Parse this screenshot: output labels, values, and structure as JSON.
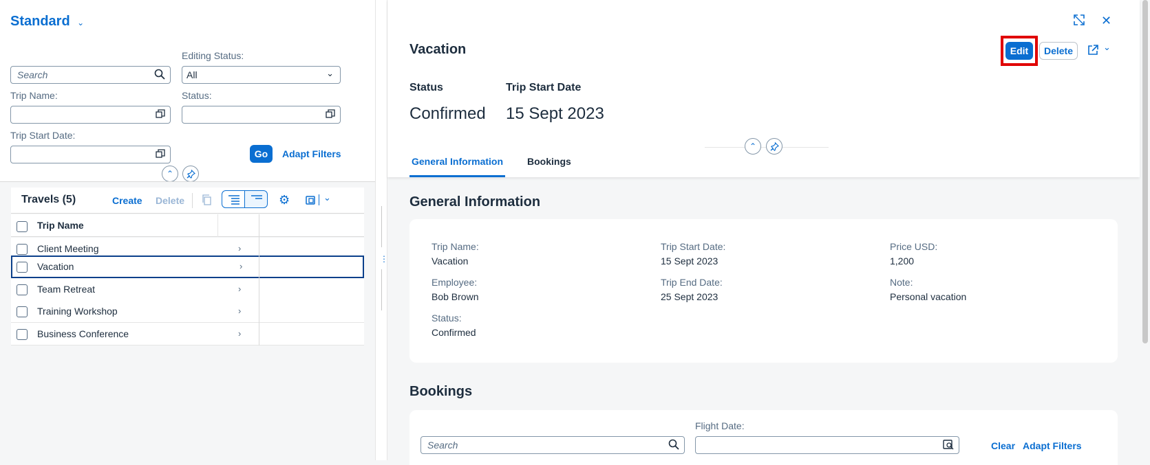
{
  "variant": {
    "title": "Standard"
  },
  "filters": {
    "search_placeholder": "Search",
    "editing_status_label": "Editing Status:",
    "editing_status_value": "All",
    "trip_name_label": "Trip Name:",
    "status_label": "Status:",
    "trip_start_date_label": "Trip Start Date:",
    "go_label": "Go",
    "adapt_filters_label": "Adapt Filters"
  },
  "table": {
    "title": "Travels (5)",
    "create_label": "Create",
    "delete_label": "Delete",
    "column_header": "Trip Name",
    "rows": [
      "Client Meeting",
      "Vacation",
      "Team Retreat",
      "Training Workshop",
      "Business Conference"
    ],
    "selected_row": "Vacation"
  },
  "object": {
    "title": "Vacation",
    "edit_label": "Edit",
    "delete_label": "Delete",
    "status_header_label": "Status",
    "status_header_value": "Confirmed",
    "start_header_label": "Trip Start Date",
    "start_header_value": "15 Sept 2023",
    "tabs": [
      "General Information",
      "Bookings"
    ],
    "active_tab": "General Information"
  },
  "general": {
    "section_title": "General Information",
    "fields": [
      {
        "label": "Trip Name:",
        "value": "Vacation"
      },
      {
        "label": "Trip Start Date:",
        "value": "15 Sept 2023"
      },
      {
        "label": "Price USD:",
        "value": "1,200"
      },
      {
        "label": "Employee:",
        "value": "Bob Brown"
      },
      {
        "label": "Trip End Date:",
        "value": "25 Sept 2023"
      },
      {
        "label": "Note:",
        "value": "Personal vacation"
      },
      {
        "label": "Status:",
        "value": "Confirmed"
      }
    ]
  },
  "bookings": {
    "section_title": "Bookings",
    "search_placeholder": "Search",
    "flight_date_label": "Flight Date:",
    "clear_label": "Clear",
    "adapt_filters_label": "Adapt Filters"
  },
  "colors": {
    "accent": "#0a6ed1",
    "highlight": "#e00000"
  }
}
